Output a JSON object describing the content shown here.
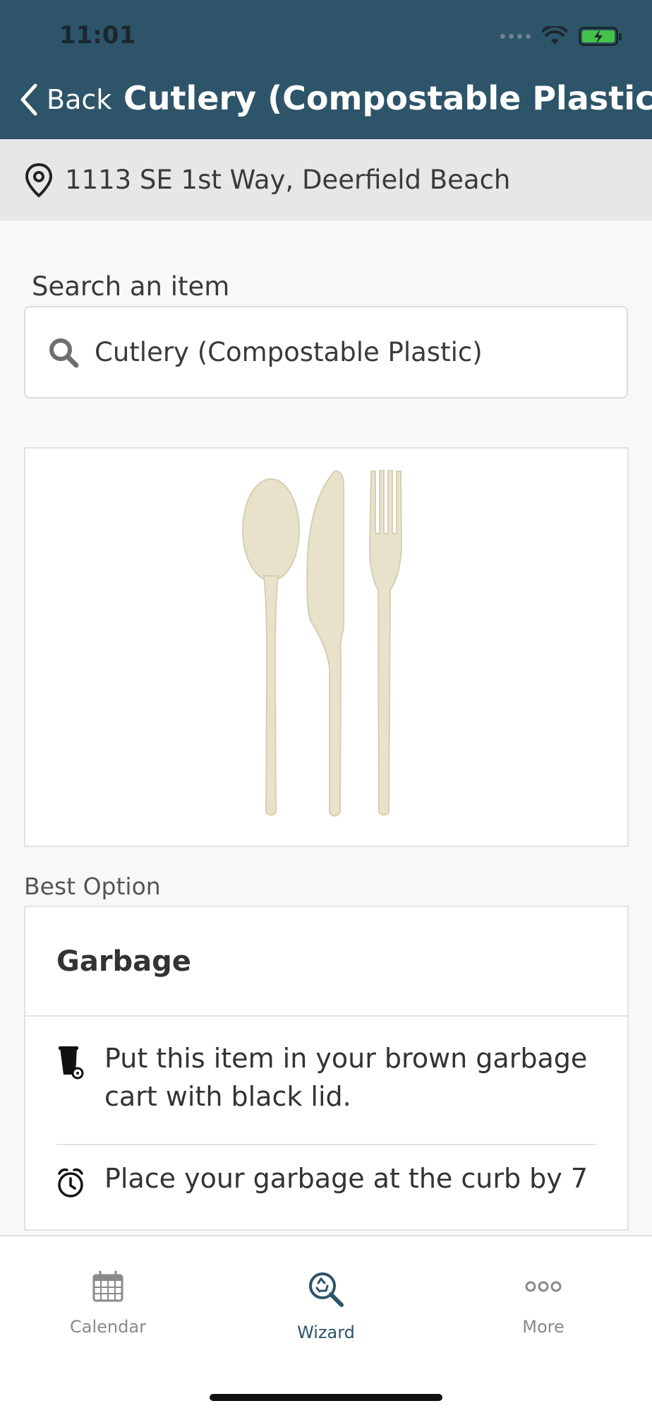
{
  "status_bar": {
    "time": "11:01"
  },
  "nav": {
    "back_label": "Back",
    "title": "Cutlery (Compostable Plastic)"
  },
  "address": {
    "text": "1113 SE 1st Way, Deerfield Beach",
    "icon": "location-pin-icon"
  },
  "search": {
    "label": "Search an item",
    "value": "Cutlery (Compostable Plastic)",
    "icon": "search-icon"
  },
  "item_image": {
    "description_icon": "cutlery-image"
  },
  "best_option": {
    "label": "Best Option",
    "title": "Garbage",
    "instructions": [
      {
        "icon": "garbage-cart-icon",
        "text_line1": "Put this item in your brown garbage",
        "text_line2": "cart with black lid."
      },
      {
        "icon": "alarm-clock-icon",
        "text_line1": "Place your garbage at the curb by 7"
      }
    ]
  },
  "tabbar": {
    "tabs": [
      {
        "label": "Calendar",
        "icon": "calendar-icon"
      },
      {
        "label": "Wizard",
        "icon": "wizard-search-icon"
      },
      {
        "label": "More",
        "icon": "more-icon"
      }
    ],
    "active_index": 1
  },
  "colors": {
    "header": "#2d5468",
    "active_tab": "#2d5468",
    "battery": "#44c24a"
  }
}
